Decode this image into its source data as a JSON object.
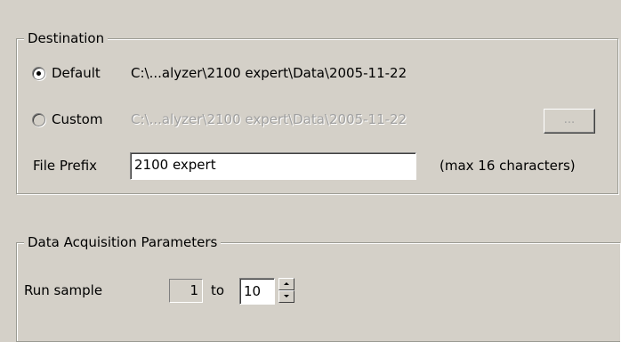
{
  "destination": {
    "legend": "Destination",
    "default_label": "Default",
    "default_path": "C:\\...alyzer\\2100 expert\\Data\\2005-11-22",
    "custom_label": "Custom",
    "custom_path": "C:\\...alyzer\\2100 expert\\Data\\2005-11-22",
    "browse_label": "...",
    "file_prefix_label": "File Prefix",
    "file_prefix_value": "2100 expert",
    "max_note": "(max 16 characters)",
    "selected": "Default"
  },
  "acquisition": {
    "legend": "Data Acquisition Parameters",
    "run_sample_label": "Run sample",
    "from_value": "1",
    "to_label": "to",
    "to_value": "10"
  }
}
